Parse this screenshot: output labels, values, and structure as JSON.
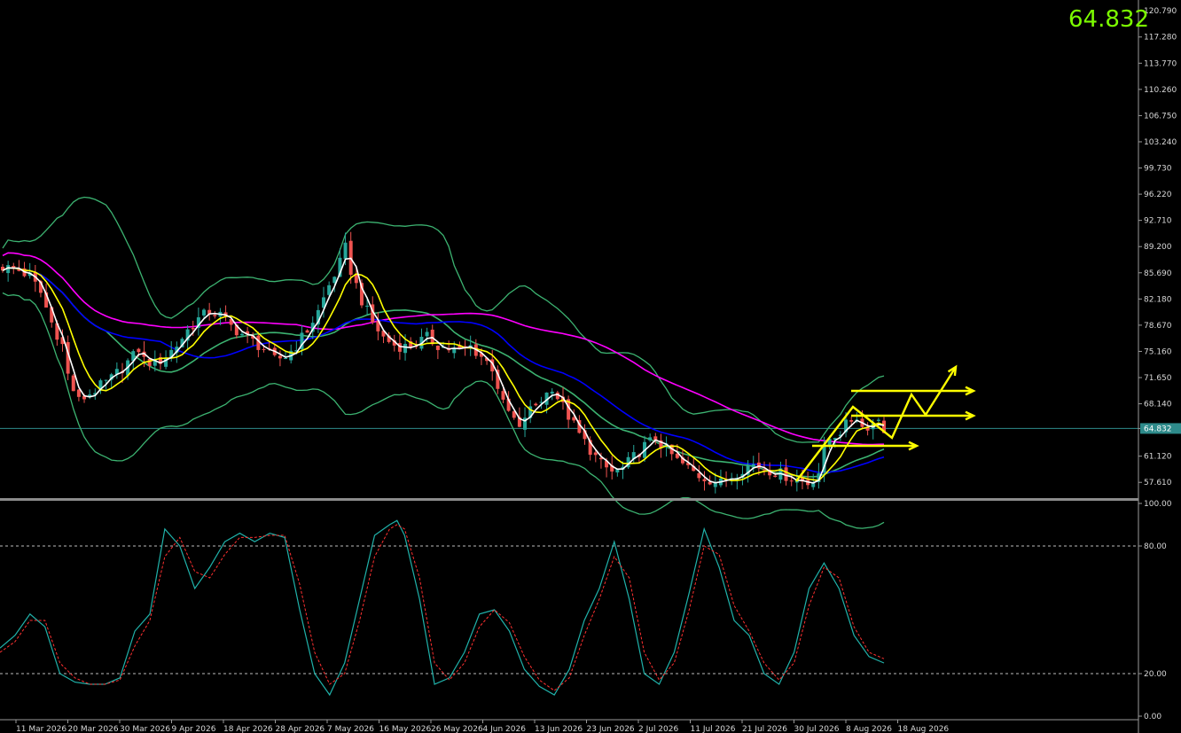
{
  "header": {
    "last_price": "64.832"
  },
  "colors": {
    "background": "#000000",
    "bull_candle": "#26a69a",
    "bear_candle": "#ef5350",
    "bollinger": "#3cb371",
    "ma_fast": "#ffffff",
    "ma_medium": "#ffff00",
    "ma_slow": "#0000ff",
    "ma_long": "#ff00ff",
    "stoch_main": "#20b2aa",
    "stoch_signal": "#ff3030",
    "projection": "#ffff00",
    "last_price_text": "#7cfc00",
    "price_line": "#2e8b8b"
  },
  "chart_data": [
    {
      "type": "candlestick",
      "panel": "price",
      "y_ticks": [
        "120.790",
        "117.280",
        "113.770",
        "110.260",
        "106.750",
        "103.240",
        "99.730",
        "96.220",
        "92.710",
        "89.200",
        "85.690",
        "82.180",
        "78.670",
        "75.160",
        "71.650",
        "68.140",
        "64.832",
        "61.120",
        "57.610"
      ],
      "ylim": [
        55.5,
        122.0
      ],
      "last_price": 64.832,
      "x_ticks": [
        "11 Mar 2026",
        "20 Mar 2026",
        "30 Mar 2026",
        "9 Apr 2026",
        "18 Apr 2026",
        "28 Apr 2026",
        "7 May 2026",
        "16 May 2026",
        "26 May 2026",
        "4 Jun 2026",
        "13 Jun 2026",
        "23 Jun 2026",
        "2 Jul 2026",
        "11 Jul 2026",
        "21 Jul 2026",
        "30 Jul 2026",
        "8 Aug 2026",
        "18 Aug 2026"
      ],
      "close_path": [
        [
          0,
          86.5
        ],
        [
          3,
          86.0
        ],
        [
          5,
          85.2
        ],
        [
          7,
          83.0
        ],
        [
          9,
          79.0
        ],
        [
          11,
          76.0
        ],
        [
          12,
          72.0
        ],
        [
          13,
          70.0
        ],
        [
          14,
          68.5
        ],
        [
          16,
          69.5
        ],
        [
          18,
          70.5
        ],
        [
          20,
          71.5
        ],
        [
          22,
          73.0
        ],
        [
          24,
          74.5
        ],
        [
          25,
          75.5
        ],
        [
          26,
          74.0
        ],
        [
          28,
          73.5
        ],
        [
          30,
          74.5
        ],
        [
          32,
          76.0
        ],
        [
          34,
          78.0
        ],
        [
          36,
          79.5
        ],
        [
          38,
          80.5
        ],
        [
          40,
          80.0
        ],
        [
          42,
          78.5
        ],
        [
          44,
          77.5
        ],
        [
          46,
          76.5
        ],
        [
          48,
          75.5
        ],
        [
          50,
          74.0
        ],
        [
          52,
          74.5
        ],
        [
          54,
          76.0
        ],
        [
          56,
          78.0
        ],
        [
          58,
          80.5
        ],
        [
          60,
          84.0
        ],
        [
          62,
          87.0
        ],
        [
          63,
          89.0
        ],
        [
          64,
          86.0
        ],
        [
          66,
          82.0
        ],
        [
          68,
          79.0
        ],
        [
          70,
          77.0
        ],
        [
          72,
          76.0
        ],
        [
          74,
          75.8
        ],
        [
          76,
          76.2
        ],
        [
          78,
          77.0
        ],
        [
          80,
          76.0
        ],
        [
          82,
          75.5
        ],
        [
          84,
          75.2
        ],
        [
          86,
          75.8
        ],
        [
          88,
          74.5
        ],
        [
          90,
          73.0
        ],
        [
          91,
          70.5
        ],
        [
          92,
          68.0
        ],
        [
          94,
          66.0
        ],
        [
          95,
          64.5
        ],
        [
          96,
          66.5
        ],
        [
          98,
          68.0
        ],
        [
          100,
          69.5
        ],
        [
          101,
          70.5
        ],
        [
          102,
          69.0
        ],
        [
          104,
          66.5
        ],
        [
          106,
          64.0
        ],
        [
          108,
          62.0
        ],
        [
          110,
          60.0
        ],
        [
          112,
          59.0
        ],
        [
          114,
          59.5
        ],
        [
          116,
          61.0
        ],
        [
          118,
          62.5
        ],
        [
          120,
          63.5
        ],
        [
          122,
          62.0
        ],
        [
          124,
          60.5
        ],
        [
          126,
          59.5
        ],
        [
          128,
          58.5
        ],
        [
          130,
          58.0
        ],
        [
          132,
          57.5
        ],
        [
          134,
          58.5
        ],
        [
          136,
          59.5
        ],
        [
          138,
          60.0
        ],
        [
          140,
          59.5
        ],
        [
          142,
          59.0
        ],
        [
          144,
          58.5
        ],
        [
          146,
          58.0
        ],
        [
          148,
          57.5
        ],
        [
          150,
          59.0
        ],
        [
          151,
          62.0
        ],
        [
          152,
          63.5
        ],
        [
          154,
          64.5
        ],
        [
          156,
          66.0
        ],
        [
          157,
          66.5
        ],
        [
          158,
          65.0
        ],
        [
          160,
          65.5
        ],
        [
          161,
          66.2
        ],
        [
          162,
          64.8
        ]
      ],
      "indicators": [
        "Bollinger Bands",
        "Moving Average (white)",
        "Moving Average (yellow)",
        "Moving Average (blue)",
        "Moving Average (magenta)"
      ]
    },
    {
      "type": "line",
      "panel": "stochastic",
      "y_ticks": [
        "100.00",
        "80.00",
        "20.00",
        "0.00"
      ],
      "ylim": [
        0,
        100
      ],
      "levels": [
        80,
        20
      ],
      "series": [
        {
          "values": [
            [
              0,
              32
            ],
            [
              2,
              38
            ],
            [
              4,
              48
            ],
            [
              6,
              42
            ],
            [
              8,
              20
            ],
            [
              10,
              16
            ],
            [
              12,
              15
            ],
            [
              14,
              15
            ],
            [
              16,
              18
            ],
            [
              18,
              40
            ],
            [
              20,
              48
            ],
            [
              22,
              88
            ],
            [
              24,
              80
            ],
            [
              26,
              60
            ],
            [
              28,
              70
            ],
            [
              30,
              82
            ],
            [
              32,
              86
            ],
            [
              34,
              82
            ],
            [
              36,
              86
            ],
            [
              38,
              84
            ],
            [
              40,
              50
            ],
            [
              42,
              20
            ],
            [
              44,
              10
            ],
            [
              46,
              25
            ],
            [
              48,
              55
            ],
            [
              50,
              85
            ],
            [
              52,
              90
            ],
            [
              53,
              92
            ],
            [
              54,
              85
            ],
            [
              56,
              55
            ],
            [
              58,
              15
            ],
            [
              60,
              18
            ],
            [
              62,
              30
            ],
            [
              64,
              48
            ],
            [
              66,
              50
            ],
            [
              68,
              40
            ],
            [
              70,
              22
            ],
            [
              72,
              14
            ],
            [
              74,
              10
            ],
            [
              76,
              22
            ],
            [
              78,
              45
            ],
            [
              80,
              60
            ],
            [
              82,
              82
            ],
            [
              84,
              55
            ],
            [
              86,
              20
            ],
            [
              88,
              15
            ],
            [
              90,
              30
            ],
            [
              92,
              58
            ],
            [
              94,
              88
            ],
            [
              96,
              70
            ],
            [
              98,
              45
            ],
            [
              100,
              38
            ],
            [
              102,
              20
            ],
            [
              104,
              15
            ],
            [
              106,
              30
            ],
            [
              108,
              60
            ],
            [
              110,
              72
            ],
            [
              112,
              60
            ],
            [
              114,
              38
            ],
            [
              116,
              28
            ],
            [
              118,
              25
            ]
          ]
        },
        {
          "values": [
            [
              0,
              30
            ],
            [
              2,
              35
            ],
            [
              4,
              45
            ],
            [
              6,
              45
            ],
            [
              8,
              25
            ],
            [
              10,
              18
            ],
            [
              12,
              15
            ],
            [
              14,
              15
            ],
            [
              16,
              17
            ],
            [
              18,
              33
            ],
            [
              20,
              45
            ],
            [
              22,
              75
            ],
            [
              24,
              84
            ],
            [
              26,
              68
            ],
            [
              28,
              65
            ],
            [
              30,
              76
            ],
            [
              32,
              84
            ],
            [
              34,
              84
            ],
            [
              36,
              85
            ],
            [
              38,
              85
            ],
            [
              40,
              62
            ],
            [
              42,
              30
            ],
            [
              44,
              15
            ],
            [
              46,
              20
            ],
            [
              48,
              45
            ],
            [
              50,
              75
            ],
            [
              52,
              88
            ],
            [
              53,
              90
            ],
            [
              54,
              88
            ],
            [
              56,
              65
            ],
            [
              58,
              25
            ],
            [
              60,
              17
            ],
            [
              62,
              25
            ],
            [
              64,
              42
            ],
            [
              66,
              50
            ],
            [
              68,
              44
            ],
            [
              70,
              28
            ],
            [
              72,
              17
            ],
            [
              74,
              12
            ],
            [
              76,
              18
            ],
            [
              78,
              38
            ],
            [
              80,
              55
            ],
            [
              82,
              75
            ],
            [
              84,
              65
            ],
            [
              86,
              30
            ],
            [
              88,
              17
            ],
            [
              90,
              25
            ],
            [
              92,
              50
            ],
            [
              94,
              80
            ],
            [
              96,
              76
            ],
            [
              98,
              52
            ],
            [
              100,
              40
            ],
            [
              102,
              25
            ],
            [
              104,
              17
            ],
            [
              106,
              25
            ],
            [
              108,
              52
            ],
            [
              110,
              70
            ],
            [
              112,
              65
            ],
            [
              114,
              42
            ],
            [
              116,
              30
            ],
            [
              118,
              27
            ]
          ]
        }
      ]
    }
  ]
}
